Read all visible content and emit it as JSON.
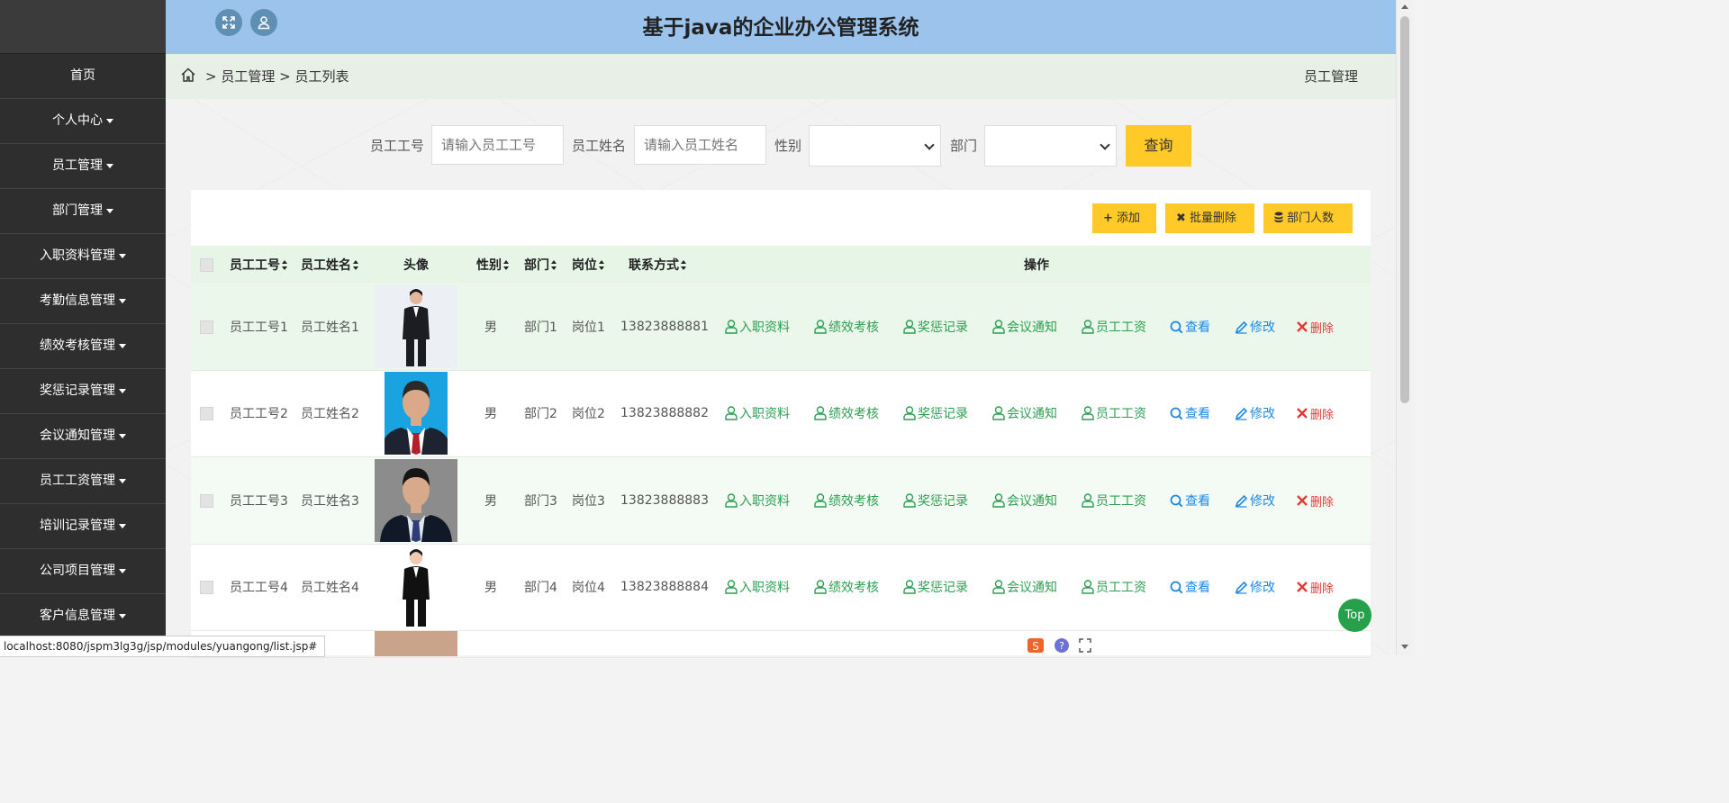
{
  "header": {
    "title": "基于java的企业办公管理系统"
  },
  "sidebar": {
    "items": [
      {
        "label": "首页",
        "dropdown": false
      },
      {
        "label": "个人中心",
        "dropdown": true
      },
      {
        "label": "员工管理",
        "dropdown": true
      },
      {
        "label": "部门管理",
        "dropdown": true
      },
      {
        "label": "入职资料管理",
        "dropdown": true
      },
      {
        "label": "考勤信息管理",
        "dropdown": true
      },
      {
        "label": "绩效考核管理",
        "dropdown": true
      },
      {
        "label": "奖惩记录管理",
        "dropdown": true
      },
      {
        "label": "会议通知管理",
        "dropdown": true
      },
      {
        "label": "员工工资管理",
        "dropdown": true
      },
      {
        "label": "培训记录管理",
        "dropdown": true
      },
      {
        "label": "公司项目管理",
        "dropdown": true
      },
      {
        "label": "客户信息管理",
        "dropdown": true
      }
    ]
  },
  "breadcrumb": {
    "sep": ">",
    "items": [
      "员工管理",
      "员工列表"
    ],
    "right_title": "员工管理"
  },
  "search": {
    "emp_no_label": "员工工号",
    "emp_no_placeholder": "请输入员工工号",
    "emp_name_label": "员工姓名",
    "emp_name_placeholder": "请输入员工姓名",
    "gender_label": "性别",
    "gender_value": "",
    "dept_label": "部门",
    "dept_value": "",
    "query_button": "查询"
  },
  "toolbar": {
    "add": "添加",
    "batch_delete": "批量删除",
    "dept_count": "部门人数"
  },
  "table": {
    "headers": [
      "员工工号",
      "员工姓名",
      "头像",
      "性别",
      "部门",
      "岗位",
      "联系方式",
      "操作"
    ],
    "actions": {
      "onboarding": "入职资料",
      "performance": "绩效考核",
      "reward": "奖惩记录",
      "meeting": "会议通知",
      "salary": "员工工资",
      "view": "查看",
      "edit": "修改",
      "delete": "删除"
    },
    "rows": [
      {
        "emp_no": "员工工号1",
        "name": "员工姓名1",
        "gender": "男",
        "dept": "部门1",
        "post": "岗位1",
        "phone": "13823888881"
      },
      {
        "emp_no": "员工工号2",
        "name": "员工姓名2",
        "gender": "男",
        "dept": "部门2",
        "post": "岗位2",
        "phone": "13823888882"
      },
      {
        "emp_no": "员工工号3",
        "name": "员工姓名3",
        "gender": "男",
        "dept": "部门3",
        "post": "岗位3",
        "phone": "13823888883"
      },
      {
        "emp_no": "员工工号4",
        "name": "员工姓名4",
        "gender": "男",
        "dept": "部门4",
        "post": "岗位4",
        "phone": "13823888884"
      }
    ]
  },
  "top_button": "Top",
  "status_url": "localhost:8080/jspm3lg3g/jsp/modules/yuangong/list.jsp#",
  "colors": {
    "header": "#9bc3ec",
    "sidebar": "#2e2e2e",
    "accent": "#ffc928",
    "action_green": "#2e9e52",
    "action_blue": "#1e88e5",
    "action_red": "#e53935"
  }
}
